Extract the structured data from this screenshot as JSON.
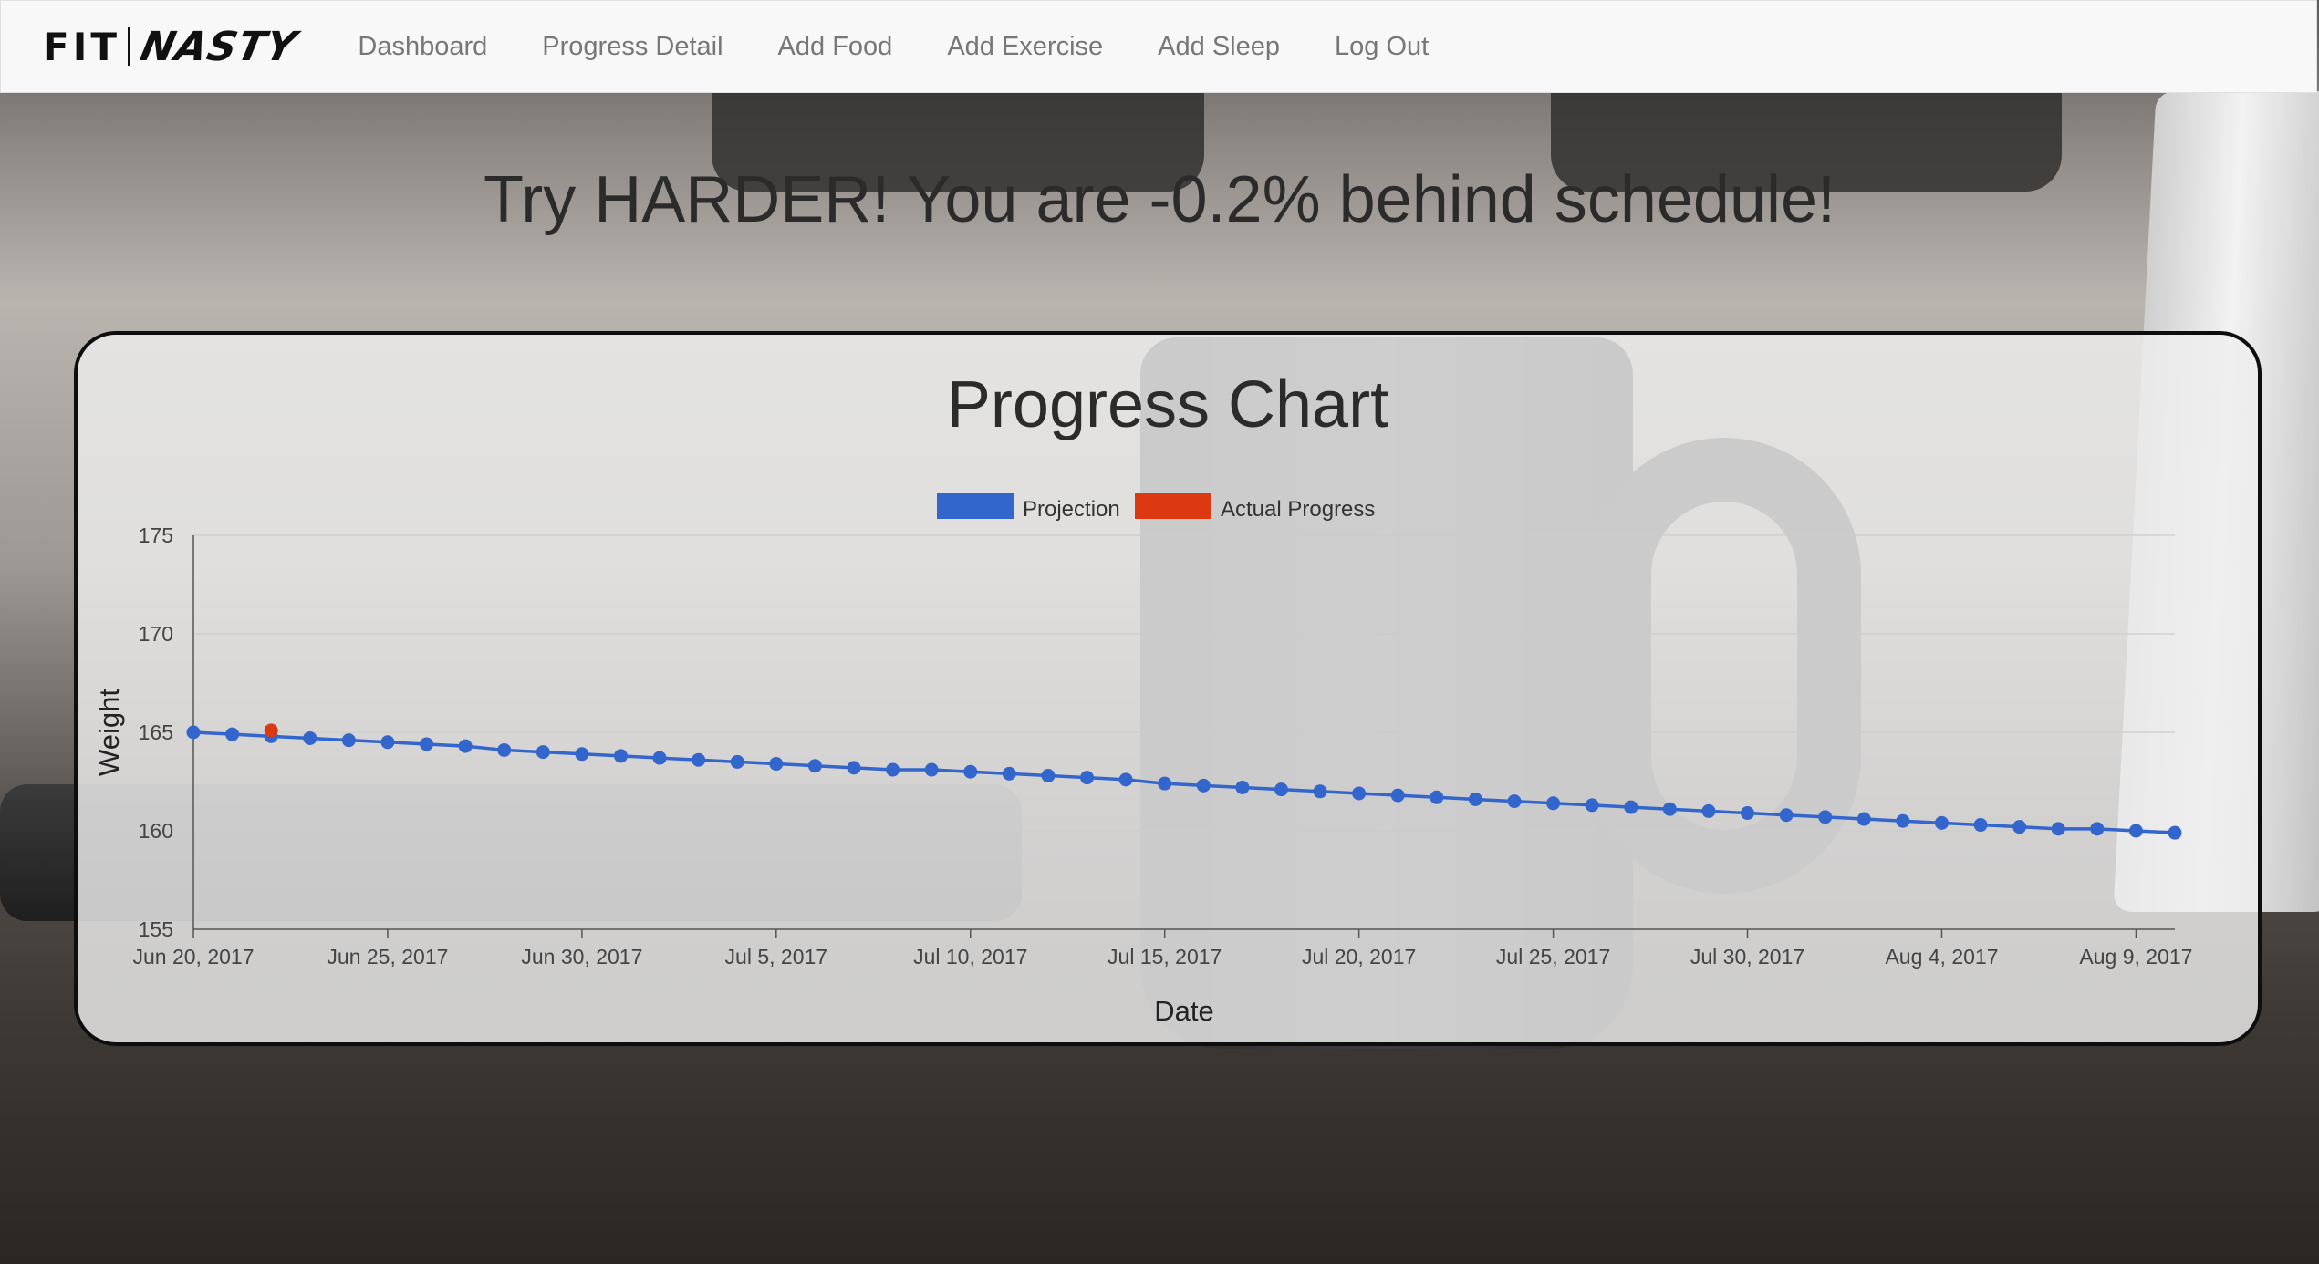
{
  "navbar": {
    "brand_left": "FIT",
    "brand_right": "NASTY",
    "links": [
      {
        "label": "Dashboard"
      },
      {
        "label": "Progress Detail"
      },
      {
        "label": "Add Food"
      },
      {
        "label": "Add Exercise"
      },
      {
        "label": "Add Sleep"
      },
      {
        "label": "Log Out"
      }
    ]
  },
  "headline": "Try HARDER! You are -0.2% behind schedule!",
  "colors": {
    "projection": "#3366cc",
    "actual": "#dc3912"
  },
  "chart_data": {
    "type": "line",
    "title": "Progress Chart",
    "xlabel": "Date",
    "ylabel": "Weight",
    "ylim": [
      155,
      175
    ],
    "yticks": [
      155,
      160,
      165,
      170,
      175
    ],
    "x_start": "Jun 20, 2017",
    "x_end": "Aug 10, 2017",
    "xticks": [
      "Jun 20, 2017",
      "Jun 25, 2017",
      "Jun 30, 2017",
      "Jul 5, 2017",
      "Jul 10, 2017",
      "Jul 15, 2017",
      "Jul 20, 2017",
      "Jul 25, 2017",
      "Jul 30, 2017",
      "Aug 4, 2017",
      "Aug 9, 2017"
    ],
    "grid": true,
    "legend": "top",
    "series": [
      {
        "name": "Projection",
        "x": [
          "Jun 20, 2017",
          "Jun 21, 2017",
          "Jun 22, 2017",
          "Jun 23, 2017",
          "Jun 24, 2017",
          "Jun 25, 2017",
          "Jun 26, 2017",
          "Jun 27, 2017",
          "Jun 28, 2017",
          "Jun 29, 2017",
          "Jun 30, 2017",
          "Jul 1, 2017",
          "Jul 2, 2017",
          "Jul 3, 2017",
          "Jul 4, 2017",
          "Jul 5, 2017",
          "Jul 6, 2017",
          "Jul 7, 2017",
          "Jul 8, 2017",
          "Jul 9, 2017",
          "Jul 10, 2017",
          "Jul 11, 2017",
          "Jul 12, 2017",
          "Jul 13, 2017",
          "Jul 14, 2017",
          "Jul 15, 2017",
          "Jul 16, 2017",
          "Jul 17, 2017",
          "Jul 18, 2017",
          "Jul 19, 2017",
          "Jul 20, 2017",
          "Jul 21, 2017",
          "Jul 22, 2017",
          "Jul 23, 2017",
          "Jul 24, 2017",
          "Jul 25, 2017",
          "Jul 26, 2017",
          "Jul 27, 2017",
          "Jul 28, 2017",
          "Jul 29, 2017",
          "Jul 30, 2017",
          "Jul 31, 2017",
          "Aug 1, 2017",
          "Aug 2, 2017",
          "Aug 3, 2017",
          "Aug 4, 2017",
          "Aug 5, 2017",
          "Aug 6, 2017",
          "Aug 7, 2017",
          "Aug 8, 2017",
          "Aug 9, 2017",
          "Aug 10, 2017"
        ],
        "values": [
          165.0,
          164.9,
          164.8,
          164.7,
          164.6,
          164.5,
          164.4,
          164.3,
          164.1,
          164.0,
          163.9,
          163.8,
          163.7,
          163.6,
          163.5,
          163.4,
          163.3,
          163.2,
          163.1,
          163.1,
          163.0,
          162.9,
          162.8,
          162.7,
          162.6,
          162.4,
          162.3,
          162.2,
          162.1,
          162.0,
          161.9,
          161.8,
          161.7,
          161.6,
          161.5,
          161.4,
          161.3,
          161.2,
          161.1,
          161.0,
          160.9,
          160.8,
          160.7,
          160.6,
          160.5,
          160.4,
          160.3,
          160.2,
          160.1,
          160.1,
          160.0,
          159.9
        ]
      },
      {
        "name": "Actual Progress",
        "x": [
          "Jun 22, 2017"
        ],
        "values": [
          165.1
        ]
      }
    ]
  }
}
